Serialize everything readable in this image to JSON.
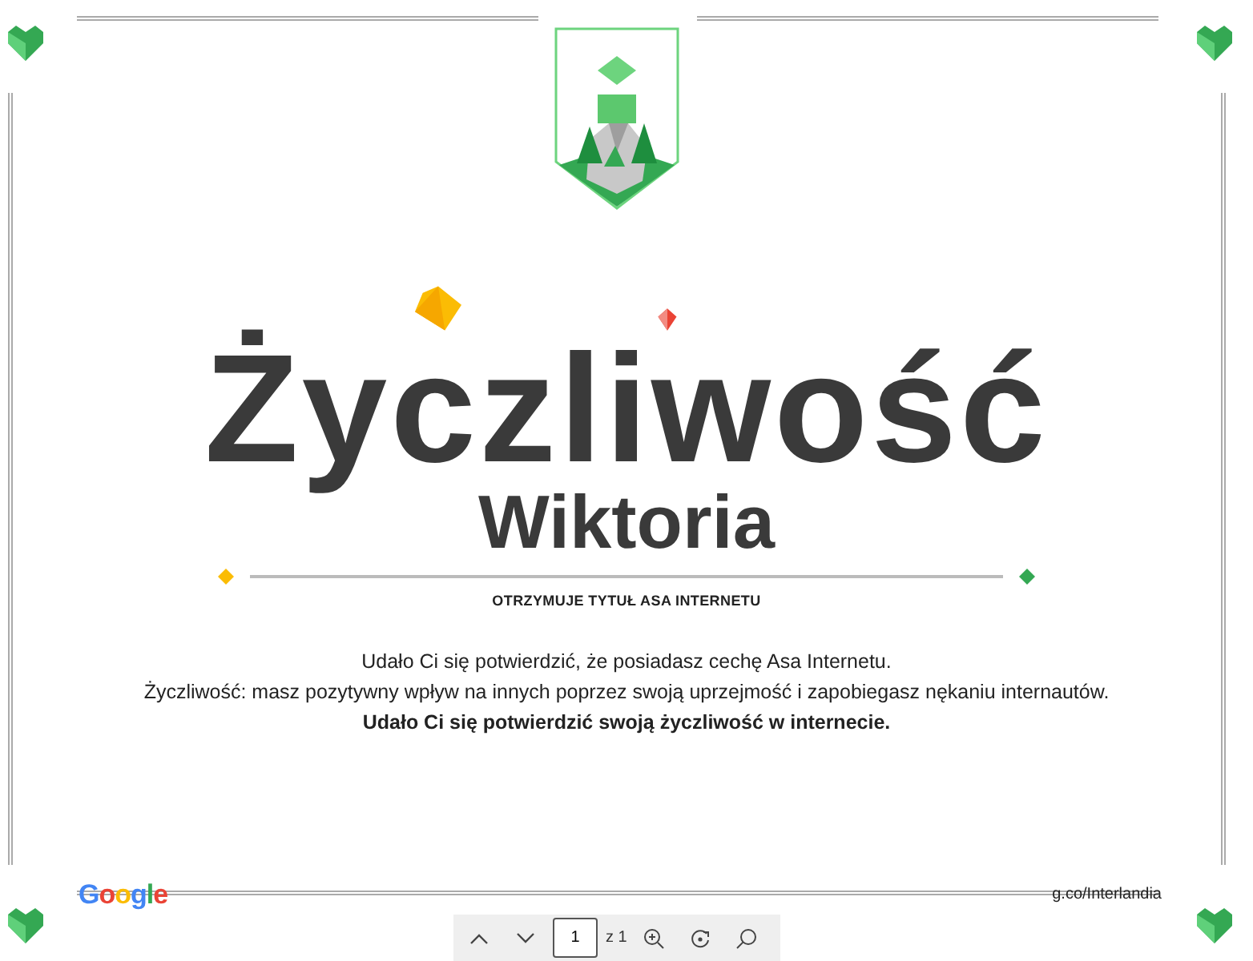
{
  "certificate": {
    "title": "Życzliwość",
    "name": "Wiktoria",
    "subtitle": "OTRZYMUJE TYTUŁ ASA INTERNETU",
    "lines": [
      "Udało Ci się potwierdzić, że posiadasz cechę Asa Internetu.",
      "Życzliwość: masz pozytywny wpływ na innych poprzez swoją uprzejmość i zapobiegasz nękaniu internautów.",
      "**Udało Ci się potwierdzić swoją życzliwość w internecie.**"
    ],
    "logo": "Google",
    "link": "g.co/Interlandia"
  },
  "toolbar": {
    "page": "1",
    "page_count": "z 1"
  }
}
